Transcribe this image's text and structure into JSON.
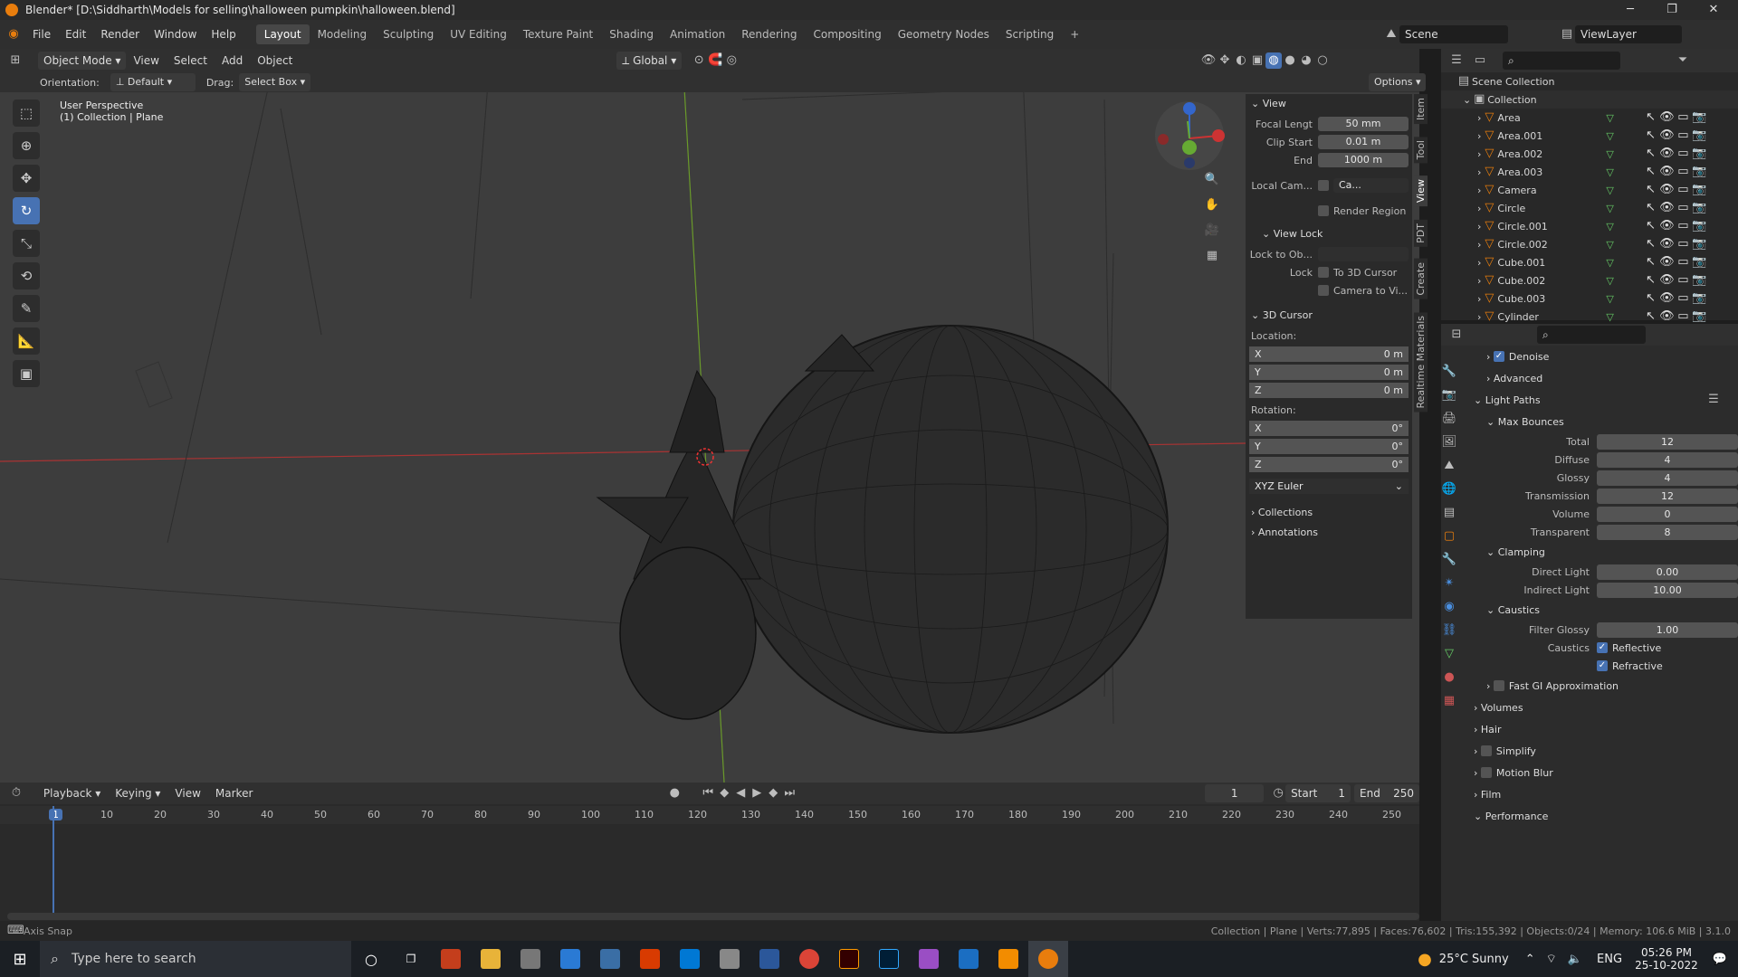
{
  "title": "Blender* [D:\\Siddharth\\Models for selling\\halloween pumpkin\\halloween.blend]",
  "menu": [
    "File",
    "Edit",
    "Render",
    "Window",
    "Help"
  ],
  "workspaces": [
    "Layout",
    "Modeling",
    "Sculpting",
    "UV Editing",
    "Texture Paint",
    "Shading",
    "Animation",
    "Rendering",
    "Compositing",
    "Geometry Nodes",
    "Scripting",
    "+"
  ],
  "scene": "Scene",
  "viewlayer": "ViewLayer",
  "hdr": {
    "mode": "Object Mode",
    "view": "View",
    "select": "Select",
    "add": "Add",
    "object": "Object",
    "orient": "Global"
  },
  "toolhdr": {
    "orientation_label": "Orientation:",
    "orientation": "Default",
    "drag_label": "Drag:",
    "drag": "Select Box",
    "options": "Options"
  },
  "viewport": {
    "persp": "User Perspective",
    "coll": "(1) Collection | Plane"
  },
  "npanel": {
    "view": "View",
    "focal_label": "Focal Lengt",
    "focal": "50 mm",
    "clip_start_label": "Clip Start",
    "clip_start": "0.01 m",
    "end_label": "End",
    "end": "1000 m",
    "local_cam_label": "Local Cam...",
    "local_cam_val": "Ca...",
    "render_region": "Render Region",
    "view_lock": "View Lock",
    "lock_to_label": "Lock to Ob...",
    "lock_label": "Lock",
    "to_cursor": "To 3D Cursor",
    "cam_to_view": "Camera to Vi...",
    "cursor": "3D Cursor",
    "location": "Location:",
    "rotation": "Rotation:",
    "loc": [
      {
        "a": "X",
        "v": "0 m"
      },
      {
        "a": "Y",
        "v": "0 m"
      },
      {
        "a": "Z",
        "v": "0 m"
      }
    ],
    "rot": [
      {
        "a": "X",
        "v": "0°"
      },
      {
        "a": "Y",
        "v": "0°"
      },
      {
        "a": "Z",
        "v": "0°"
      }
    ],
    "euler": "XYZ Euler",
    "collections": "Collections",
    "annotations": "Annotations"
  },
  "tabs": [
    "Item",
    "Tool",
    "View",
    "PDT",
    "Create",
    "Realtime Materials"
  ],
  "outliner": {
    "root": "Scene Collection",
    "collection": "Collection",
    "items": [
      "Area",
      "Area.001",
      "Area.002",
      "Area.003",
      "Camera",
      "Circle",
      "Circle.001",
      "Circle.002",
      "Cube.001",
      "Cube.002",
      "Cube.003",
      "Cylinder"
    ]
  },
  "props": {
    "denoise": "Denoise",
    "advanced": "Advanced",
    "light_paths": "Light Paths",
    "max_bounces": "Max Bounces",
    "bounces": [
      {
        "l": "Total",
        "v": "12"
      },
      {
        "l": "Diffuse",
        "v": "4"
      },
      {
        "l": "Glossy",
        "v": "4"
      },
      {
        "l": "Transmission",
        "v": "12"
      },
      {
        "l": "Volume",
        "v": "0"
      },
      {
        "l": "Transparent",
        "v": "8"
      }
    ],
    "clamping": "Clamping",
    "direct_label": "Direct Light",
    "direct": "0.00",
    "indirect_label": "Indirect Light",
    "indirect": "10.00",
    "caustics": "Caustics",
    "filter_label": "Filter Glossy",
    "filter": "1.00",
    "caustics_label": "Caustics",
    "reflective": "Reflective",
    "refractive": "Refractive",
    "fast_gi": "Fast GI Approximation",
    "volumes": "Volumes",
    "hair": "Hair",
    "simplify": "Simplify",
    "motion_blur": "Motion Blur",
    "film": "Film",
    "performance": "Performance"
  },
  "timeline": {
    "playback": "Playback",
    "keying": "Keying",
    "view": "View",
    "marker": "Marker",
    "frame": "1",
    "start_label": "Start",
    "start": "1",
    "end_label": "End",
    "end": "250",
    "ticks": [
      "1",
      "10",
      "20",
      "30",
      "40",
      "50",
      "60",
      "70",
      "80",
      "90",
      "100",
      "110",
      "120",
      "130",
      "140",
      "150",
      "160",
      "170",
      "180",
      "190",
      "200",
      "210",
      "220",
      "230",
      "240",
      "250"
    ]
  },
  "status": {
    "left": "Axis Snap",
    "right": "Collection | Plane | Verts:77,895 | Faces:76,602 | Tris:155,392 | Objects:0/24 | Memory: 106.6 MiB | 3.1.0"
  },
  "taskbar": {
    "search": "Type here to search",
    "weather": "25°C  Sunny",
    "lang": "ENG",
    "time": "05:26 PM",
    "date": "25-10-2022"
  }
}
